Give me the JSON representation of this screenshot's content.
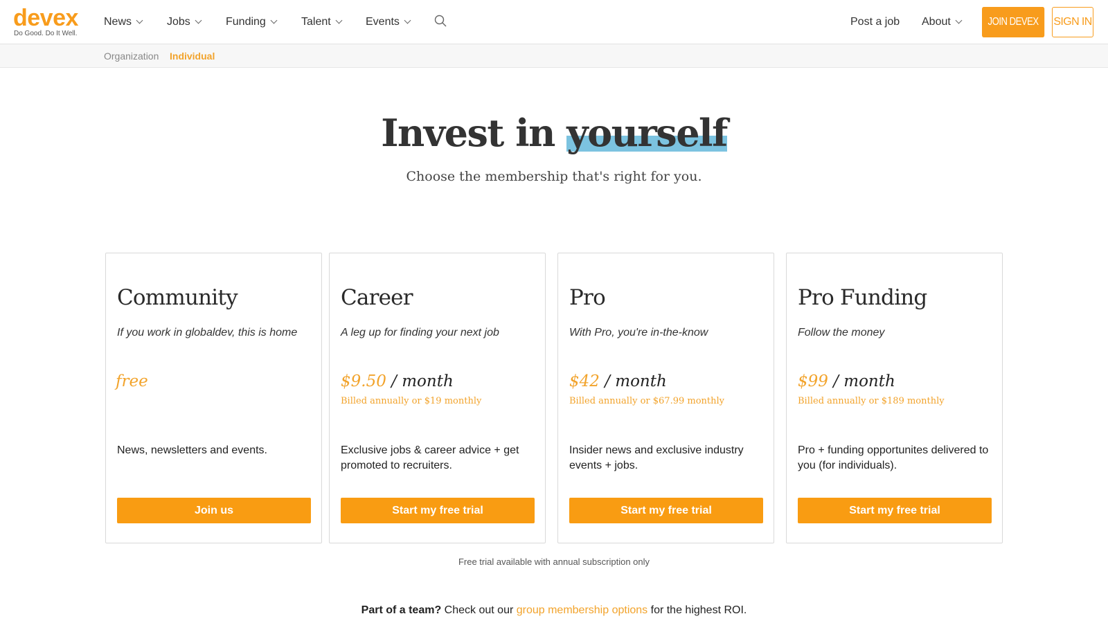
{
  "header": {
    "logo_word": "devex",
    "logo_tagline": "Do Good. Do It Well.",
    "nav": [
      {
        "label": "News"
      },
      {
        "label": "Jobs"
      },
      {
        "label": "Funding"
      },
      {
        "label": "Talent"
      },
      {
        "label": "Events"
      }
    ],
    "post_job": "Post a job",
    "about": "About",
    "join_button": "Join Devex",
    "signin_button": "Sign In",
    "accent_color": "#f89c1c"
  },
  "subnav": {
    "items": [
      {
        "label": "Organization",
        "active": false
      },
      {
        "label": "Individual",
        "active": true
      }
    ]
  },
  "hero": {
    "title_prefix": "Invest in ",
    "title_highlight": "yourself",
    "subtitle": "Choose the membership that's right for you."
  },
  "plans": [
    {
      "name": "Community",
      "tagline": "If you work in globaldev, this is home",
      "price": "free",
      "period": "",
      "billing": "",
      "description": "News, newsletters and events.",
      "button": "Join us"
    },
    {
      "name": "Career",
      "tagline": "A leg up for finding your next job",
      "price": "$9.50",
      "period": " / month",
      "billing": "Billed annually or $19 monthly",
      "description": "Exclusive jobs & career advice + get promoted to recruiters.",
      "button": "Start my free trial"
    },
    {
      "name": "Pro",
      "tagline": "With Pro, you're in-the-know",
      "price": "$42",
      "period": " / month",
      "billing": "Billed annually or $67.99 monthly",
      "description": "Insider news and exclusive industry events + jobs.",
      "button": "Start my free trial"
    },
    {
      "name": "Pro Funding",
      "tagline": "Follow the money",
      "price": "$99",
      "period": " / month",
      "billing": "Billed annually or $189 monthly",
      "description": "Pro + funding opportunites delivered to you (for individuals).",
      "button": "Start my free trial"
    }
  ],
  "trial_note": "Free trial available with annual subscription only",
  "team": {
    "bold": "Part of a team?",
    "text_before": " Check out our ",
    "link": "group membership options",
    "text_after": " for the highest ROI."
  }
}
